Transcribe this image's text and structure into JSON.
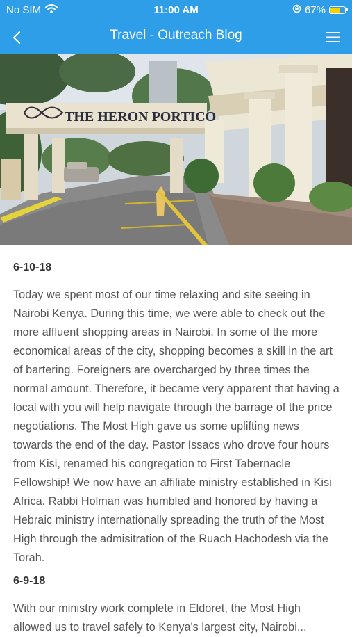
{
  "status_bar": {
    "carrier": "No SIM",
    "time": "11:00 AM",
    "battery": "67%",
    "battery_level": 0.67
  },
  "nav": {
    "title": "Travel - Outreach Blog"
  },
  "hero": {
    "sign_text": "THE HERON PORTICO"
  },
  "entries": [
    {
      "date": "6-10-18",
      "text": "Today we spent most of our time relaxing and site seeing in Nairobi Kenya. During this time, we were able to check out the more affluent shopping areas in Nairobi. In some of the more economical areas of the city, shopping becomes a skill in the art of bartering. Foreigners are overcharged by three times the normal amount. Therefore, it became very apparent that having a local with you will help navigate through the barrage of the price negotiations. The Most High gave us some uplifting news towards the end of the day. Pastor Issacs who drove four hours from Kisi, renamed his congregation to First Tabernacle Fellowship! We now have an affiliate ministry established in Kisi Africa. Rabbi Holman was humbled and honored by having a Hebraic ministry internationally spreading the truth of the Most High through the admisitration of the Ruach Hachodesh via the Torah."
    },
    {
      "date": "6-9-18",
      "text": "With our ministry work complete in Eldoret, the Most High allowed us to travel safely to Kenya's largest city, Nairobi..."
    }
  ],
  "colors": {
    "nav_bg": "#2e9ee8",
    "nav_text": "#ffffff",
    "body_text": "#555555"
  }
}
